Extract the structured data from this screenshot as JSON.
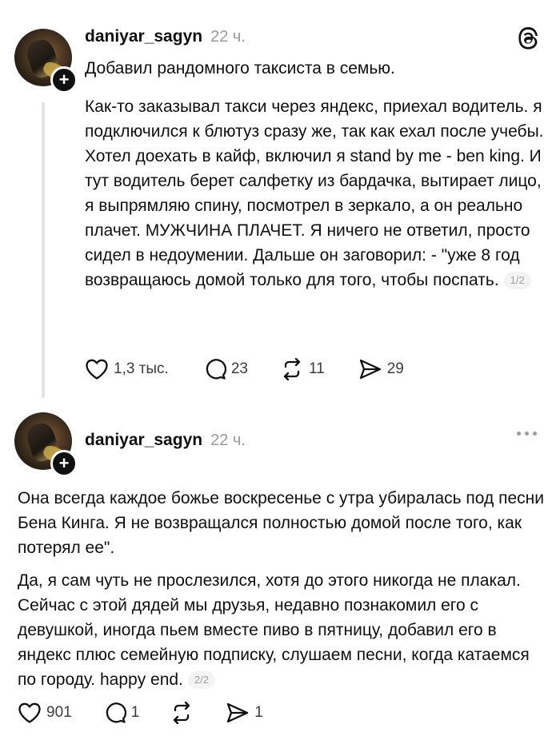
{
  "post1": {
    "username": "daniyar_sagyn",
    "time": "22 ч.",
    "title": "Добавил рандомного таксиста в семью.",
    "text": "Как-то заказывал такси через яндекс, приехал водитель. я подключился к блютуз сразу же, так как ехал после учебы. Хотел доехать в кайф, включил я stand by me - ben king. И тут водитель берет салфетку из бардачка, вытирает лицо, я выпрямляю спину, посмотрел в зеркало, а он реально плачет. МУЖЧИНА ПЛАЧЕТ. Я ничего не ответил, просто сидел в недоумении. Дальше он заговорил: - \"уже 8 год возвращаюсь домой только для того, чтобы поспать.",
    "page": "1/2",
    "likes": "1,3 тыс.",
    "replies": "23",
    "reposts": "11",
    "shares": "29"
  },
  "post2": {
    "username": "daniyar_sagyn",
    "time": "22 ч.",
    "para1": "Она всегда каждое божье воскресенье с утра убиралась под песни Бена Кинга. Я не возвращался полностью домой после того, как потерял ее\".",
    "para2": "Да, я сам чуть не прослезился, хотя до этого никогда не плакал. Сейчас с этой дядей мы друзья, недавно познакомил его с девушкой, иногда пьем вместе пиво в пятницу, добавил его в яндекс плюс семейную подписку, слушаем песни, когда катаемся по городу. happy end.",
    "page": "2/2",
    "likes": "901",
    "replies": "1",
    "shares": "1"
  },
  "icons": {
    "app_logo": "threads-logo-icon",
    "more": "more-dots-icon",
    "like": "heart-icon",
    "reply": "comment-bubble-icon",
    "repost": "repost-arrows-icon",
    "share": "send-paper-plane-icon",
    "follow": "plus-icon"
  }
}
